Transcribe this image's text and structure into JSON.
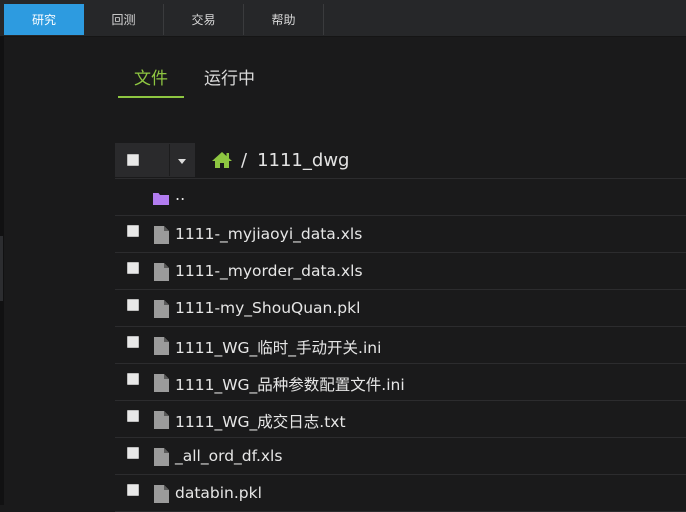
{
  "topnav": {
    "tabs": [
      {
        "label": "研究",
        "active": true
      },
      {
        "label": "回测",
        "active": false
      },
      {
        "label": "交易",
        "active": false
      },
      {
        "label": "帮助",
        "active": false
      }
    ]
  },
  "content_tabs": [
    {
      "label": "文件",
      "active": true
    },
    {
      "label": "运行中",
      "active": false
    }
  ],
  "breadcrumb": {
    "separator": "/",
    "current": "1111_dwg"
  },
  "files": {
    "parent": "..",
    "items": [
      "1111-_myjiaoyi_data.xls",
      "1111-_myorder_data.xls",
      "1111-my_ShouQuan.pkl",
      "1111_WG_临时_手动开关.ini",
      "1111_WG_品种参数配置文件.ini",
      "1111_WG_成交日志.txt",
      "_all_ord_df.xls",
      "databin.pkl"
    ]
  },
  "colors": {
    "nav_active": "#2d9be0",
    "accent_green": "#8ec641",
    "folder_purple": "#b27cf0",
    "file_gray": "#9b9b9b"
  }
}
